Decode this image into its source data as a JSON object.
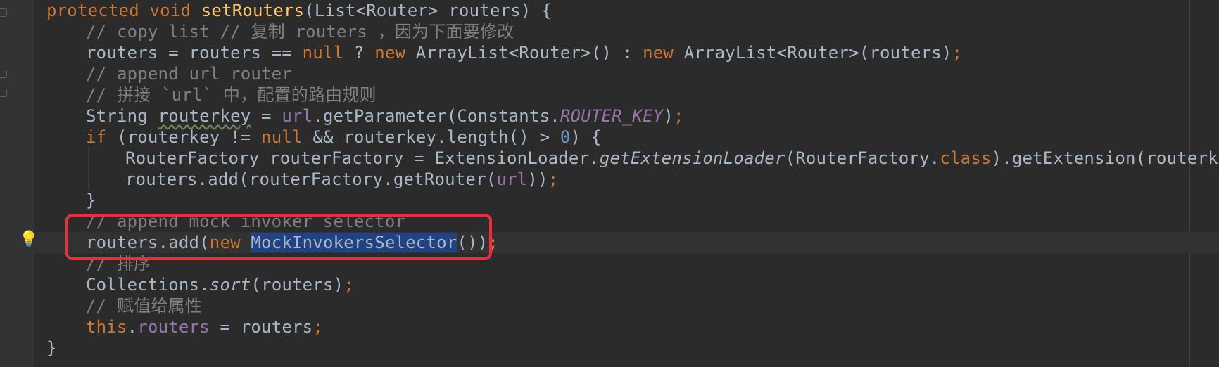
{
  "code": {
    "l1": {
      "kw1": "protected",
      "kw2": "void",
      "fn": "setRouters",
      "rest": "(List<Router> routers) {"
    },
    "l2": {
      "comment": "// copy list // 复制 routers ，因为下面要修改"
    },
    "l3": {
      "a": "routers = routers == ",
      "null": "null",
      "b": " ? ",
      "new1": "new",
      "c": " ArrayList<Router>() : ",
      "new2": "new",
      "d": " ArrayList<Router>(routers)",
      "semi": ";"
    },
    "l4": {
      "comment": "// append url router"
    },
    "l5": {
      "comment": "// 拼接 `url` 中，配置的路由规则"
    },
    "l6": {
      "a": "String ",
      "var": "routerkey",
      "b": " = ",
      "url": "url",
      "c": ".getParameter(Constants.",
      "const": "ROUTER_KEY",
      "d": ")",
      "semi": ";"
    },
    "l7": {
      "if": "if",
      "a": " (routerkey != ",
      "null": "null",
      "b": " && routerkey.length() > ",
      "num": "0",
      "c": ") {"
    },
    "l8": {
      "a": "RouterFactory routerFactory = ExtensionLoader.",
      "method": "getExtensionLoader",
      "b": "(RouterFactory.",
      "class": "class",
      "c": ").getExtension(routerkey)",
      "semi": ";"
    },
    "l9": {
      "a": "routers.add(routerFactory.getRouter(",
      "url": "url",
      "b": "))",
      "semi": ";"
    },
    "l10": {
      "brace": "}"
    },
    "l11": {
      "comment": "// append mock invoker selector"
    },
    "l12": {
      "a": "routers.add(",
      "new": "new",
      "sp": " ",
      "sel": "MockInvokersSelector",
      "b": "())",
      "semi": ";"
    },
    "l13": {
      "comment": "// 排序"
    },
    "l14": {
      "a": "Collections.",
      "method": "sort",
      "b": "(routers)",
      "semi": ";"
    },
    "l15": {
      "comment": "// 赋值给属性"
    },
    "l16": {
      "this": "this",
      "dot": ".",
      "field": "routers",
      "b": " = routers",
      "semi": ";"
    },
    "l17": {
      "brace": "}"
    }
  },
  "colors": {
    "background": "#2b2b2b",
    "keyword": "#cc7832",
    "method_declaration": "#ffc66d",
    "comment": "#808080",
    "number": "#6897bb",
    "field": "#9876aa",
    "selection": "#214283",
    "highlight_box": "#e8303c"
  },
  "gutter": {
    "intention_icon": "lightbulb-icon"
  }
}
